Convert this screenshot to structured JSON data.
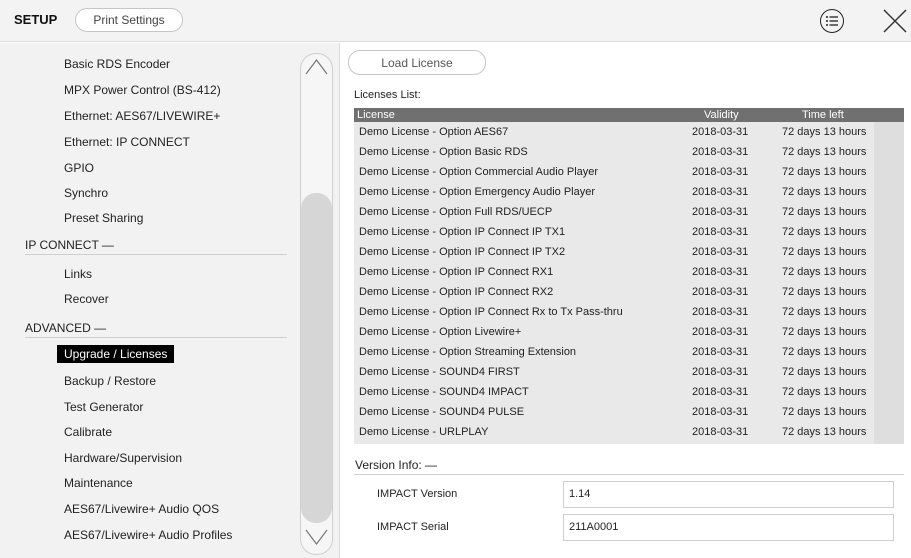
{
  "header": {
    "title": "SETUP",
    "print_settings_label": "Print Settings",
    "menu_icon": "list-icon",
    "close_icon": "close-icon"
  },
  "sidebar": {
    "items_top": [
      "Basic RDS Encoder",
      "MPX Power Control (BS-412)",
      "Ethernet: AES67/LIVEWIRE+",
      "Ethernet: IP CONNECT",
      "GPIO",
      "Synchro",
      "Preset Sharing"
    ],
    "section_ip": "IP CONNECT  —",
    "items_ip": [
      "Links",
      "Recover"
    ],
    "section_advanced": "ADVANCED  —",
    "items_advanced": [
      "Upgrade / Licenses",
      "Backup / Restore",
      "Test Generator",
      "Calibrate",
      "Hardware/Supervision",
      "Maintenance",
      "AES67/Livewire+ Audio QOS",
      "AES67/Livewire+ Audio Profiles"
    ],
    "active_item": "Upgrade / Licenses"
  },
  "main": {
    "load_license_label": "Load License",
    "licenses_list_label": "Licenses List:",
    "table": {
      "headers": [
        "License",
        "Validity",
        "Time left"
      ],
      "rows": [
        [
          "Demo License - Option AES67",
          "2018-03-31",
          "72 days 13 hours"
        ],
        [
          "Demo License - Option Basic RDS",
          "2018-03-31",
          "72 days 13 hours"
        ],
        [
          "Demo License - Option Commercial Audio Player",
          "2018-03-31",
          "72 days 13 hours"
        ],
        [
          "Demo License - Option Emergency Audio Player",
          "2018-03-31",
          "72 days 13 hours"
        ],
        [
          "Demo License - Option Full RDS/UECP",
          "2018-03-31",
          "72 days 13 hours"
        ],
        [
          "Demo License - Option IP Connect IP TX1",
          "2018-03-31",
          "72 days 13 hours"
        ],
        [
          "Demo License - Option IP Connect IP TX2",
          "2018-03-31",
          "72 days 13 hours"
        ],
        [
          "Demo License - Option IP Connect RX1",
          "2018-03-31",
          "72 days 13 hours"
        ],
        [
          "Demo License - Option IP Connect RX2",
          "2018-03-31",
          "72 days 13 hours"
        ],
        [
          "Demo License - Option IP Connect Rx to Tx Pass-thru",
          "2018-03-31",
          "72 days 13 hours"
        ],
        [
          "Demo License - Option Livewire+",
          "2018-03-31",
          "72 days 13 hours"
        ],
        [
          "Demo License - Option Streaming Extension",
          "2018-03-31",
          "72 days 13 hours"
        ],
        [
          "Demo License - SOUND4 FIRST",
          "2018-03-31",
          "72 days 13 hours"
        ],
        [
          "Demo License - SOUND4 IMPACT",
          "2018-03-31",
          "72 days 13 hours"
        ],
        [
          "Demo License - SOUND4 PULSE",
          "2018-03-31",
          "72 days 13 hours"
        ],
        [
          "Demo License - URLPLAY",
          "2018-03-31",
          "72 days 13 hours"
        ]
      ]
    },
    "version_info_label": "Version Info:  —",
    "version_label": "IMPACT Version",
    "version_value": "1.14",
    "serial_label": "IMPACT Serial",
    "serial_value": "211A0001"
  }
}
